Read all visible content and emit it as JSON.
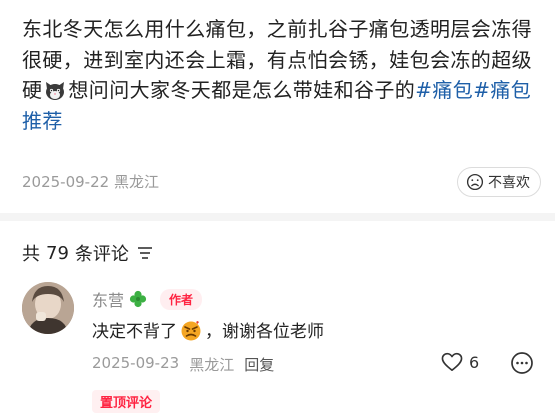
{
  "post": {
    "body_part1": "东北冬天怎么用什么痛包，之前扎谷子痛包透明层会冻得很硬，进到室内还会上霜，有点怕会锈，娃包会冻的超级硬",
    "body_part2": "想问问大家冬天都是怎么带娃和谷子的",
    "hashtags": [
      "#痛包",
      "#痛包推荐"
    ],
    "date": "2025-09-22",
    "location": "黑龙江",
    "dislike_label": "不喜欢",
    "emoji_icon": "cat-face-emoji"
  },
  "comments_section": {
    "prefix": "共",
    "count": "79",
    "suffix": "条评论"
  },
  "comment": {
    "username": "东营",
    "author_badge": "作者",
    "text_part1": "决定不背了",
    "text_part2": "，谢谢各位老师",
    "date": "2025-09-23",
    "location": "黑龙江",
    "reply_label": "回复",
    "like_count": "6",
    "pinned_label": "置顶评论"
  },
  "colors": {
    "hashtag": "#1e5fa8",
    "accent_red": "#ff2442",
    "meta_gray": "#9a9a9a"
  }
}
